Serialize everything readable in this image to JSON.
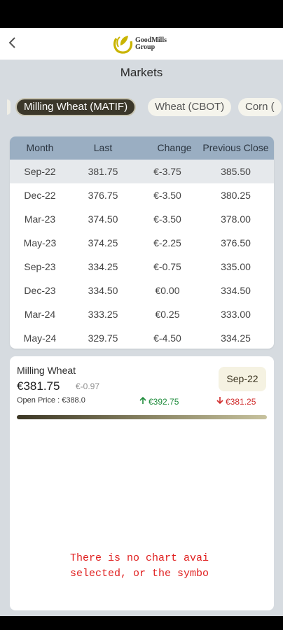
{
  "header": {
    "logo_line1": "GoodMills",
    "logo_line2": "Group"
  },
  "page": {
    "title": "Markets"
  },
  "tabs": [
    {
      "label": "Milling Wheat (MATIF)",
      "active": true
    },
    {
      "label": "Wheat (CBOT)",
      "active": false
    },
    {
      "label": "Corn (",
      "active": false
    }
  ],
  "table": {
    "headers": [
      "Month",
      "Last",
      "Change",
      "Previous Close"
    ],
    "rows": [
      {
        "month": "Sep-22",
        "last": "381.75",
        "change": "€-3.75",
        "prev_close": "385.50",
        "selected": true
      },
      {
        "month": "Dec-22",
        "last": "376.75",
        "change": "€-3.50",
        "prev_close": "380.25"
      },
      {
        "month": "Mar-23",
        "last": "374.50",
        "change": "€-3.50",
        "prev_close": "378.00"
      },
      {
        "month": "May-23",
        "last": "374.25",
        "change": "€-2.25",
        "prev_close": "376.50"
      },
      {
        "month": "Sep-23",
        "last": "334.25",
        "change": "€-0.75",
        "prev_close": "335.00"
      },
      {
        "month": "Dec-23",
        "last": "334.50",
        "change": "€0.00",
        "prev_close": "334.50"
      },
      {
        "month": "Mar-24",
        "last": "333.25",
        "change": "€0.25",
        "prev_close": "333.00"
      },
      {
        "month": "May-24",
        "last": "329.75",
        "change": "€-4.50",
        "prev_close": "334.25"
      }
    ]
  },
  "detail": {
    "name": "Milling Wheat",
    "price": "€381.75",
    "change": "€-0.97",
    "open_label": "Open Price : ",
    "open_value": "€388.0",
    "high": "€392.75",
    "low": "€381.25",
    "month": "Sep-22",
    "no_chart_line1": "There is no chart avai",
    "no_chart_line2": "selected, or the symbo"
  },
  "colors": {
    "background": "#d6dbe0",
    "table_header": "#9aaec2",
    "active_tab": "#3b372a",
    "up": "#1f8c3c",
    "down": "#d02a2a",
    "message": "#e02020"
  },
  "icons": {
    "back": "chevron-left-icon",
    "logo": "goodmills-logo-icon",
    "up": "arrow-up-icon",
    "down": "arrow-down-icon"
  }
}
